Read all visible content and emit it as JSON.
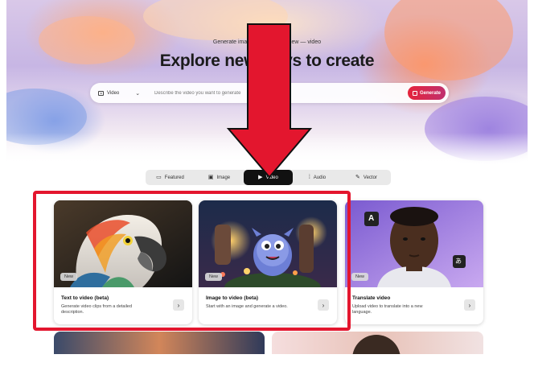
{
  "hero": {
    "subtitle": "Generate images, text, audio, new — video",
    "title": "Explore new ways to create"
  },
  "prompt_bar": {
    "type_value": "Video",
    "placeholder": "Describe the video you want to generate",
    "generate_label": "Generate"
  },
  "tabs": [
    {
      "label": "Featured",
      "icon": "chat-icon"
    },
    {
      "label": "Image",
      "icon": "image-icon"
    },
    {
      "label": "Video",
      "icon": "video-icon",
      "active": true
    },
    {
      "label": "Audio",
      "icon": "audio-icon"
    },
    {
      "label": "Vector",
      "icon": "vector-icon"
    }
  ],
  "cards": [
    {
      "badge": "New",
      "title": "Text to video (beta)",
      "description": "Generate video clips from a detailed description.",
      "arrow": "›"
    },
    {
      "badge": "New",
      "title": "Image to video (beta)",
      "description": "Start with an image and generate a video.",
      "arrow": "›"
    },
    {
      "badge": "New",
      "title": "Translate video",
      "description": "Upload video to translate into a new language.",
      "arrow": "›"
    }
  ],
  "translate_glyphs": {
    "latin": "A",
    "other": "あ"
  },
  "colors": {
    "annotation": "#e3162e",
    "generate_start": "#e5243b",
    "generate_end": "#c0306e",
    "active_tab": "#111111"
  }
}
